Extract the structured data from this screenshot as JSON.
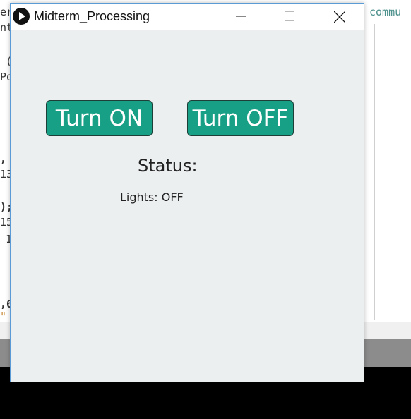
{
  "window": {
    "title": "Midterm_Processing",
    "controls": [
      "minimize",
      "maximize",
      "close"
    ]
  },
  "buttons": {
    "on_label": "Turn ON",
    "off_label": "Turn OFF"
  },
  "status": {
    "heading": "Status:",
    "lights": "Lights: OFF"
  },
  "editor_background": {
    "fragments": [
      "er",
      "nt",
      "(",
      "Po",
      ",",
      "13",
      ");",
      "15",
      "1",
      ",6",
      "\"",
      "commu"
    ]
  },
  "colors": {
    "button_fill": "#17a085",
    "button_text": "#ffffff",
    "canvas_bg": "#eceff0",
    "window_border": "#5a9bd6"
  }
}
